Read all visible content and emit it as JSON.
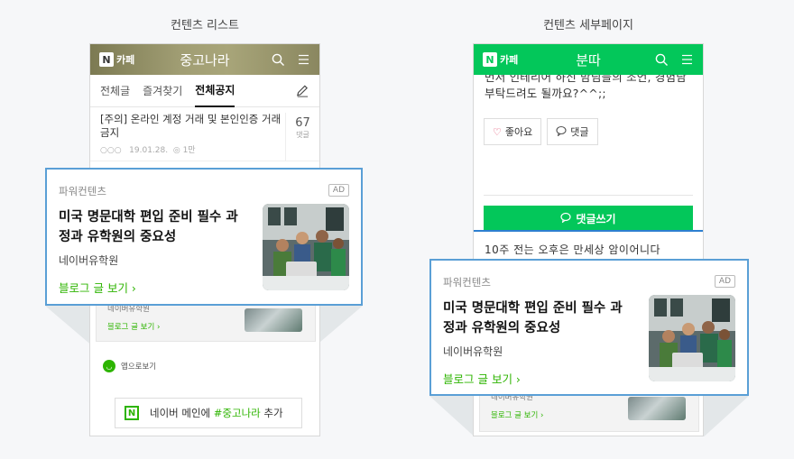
{
  "captions": {
    "left": "컨텐츠 리스트",
    "right": "컨텐츠 세부페이지"
  },
  "left_phone": {
    "cafe_label": "카페",
    "title": "중고나라",
    "tabs": [
      "전체글",
      "즐겨찾기",
      "전체공지"
    ],
    "active_tab": "전체공지",
    "notice": {
      "title": "[주의] 온라인 계정 거래 및 본인인증 거래 금지",
      "author": "○○○",
      "date": "19.01.28.",
      "views": "1만",
      "comment_count": "67",
      "comment_label": "댓글"
    },
    "ghost_ad": {
      "sub": "네이버유학원",
      "link": "블로그 글 보기 ›"
    },
    "app_view": "앱으로보기",
    "main_add": {
      "prefix": "네이버 메인에",
      "highlight": "#중고나라",
      "suffix": "추가"
    }
  },
  "right_phone": {
    "cafe_label": "카페",
    "title": "분따",
    "post_text": "먼저 인테리어 하신 맘님들의 조언, 경험담 부탁드려도 될까요?^^;;",
    "like_label": "좋아요",
    "comment_label": "댓글",
    "write_comment": "댓글쓰기",
    "peek_text": "10주 전는 오후은 만세상 암이어니다",
    "ghost_ad": {
      "sub": "네이버유학원",
      "link": "블로그 글 보기 ›"
    }
  },
  "ad": {
    "label": "파워컨텐츠",
    "badge": "AD",
    "title": "미국 명문대학 편입 준비 필수 과정과 유학원의 중요성",
    "advertiser": "네이버유학원",
    "link": "블로그 글 보기 ›"
  },
  "colors": {
    "naver_green": "#03c75a",
    "link_green": "#2db400",
    "highlight_border": "#5a9fd6"
  }
}
